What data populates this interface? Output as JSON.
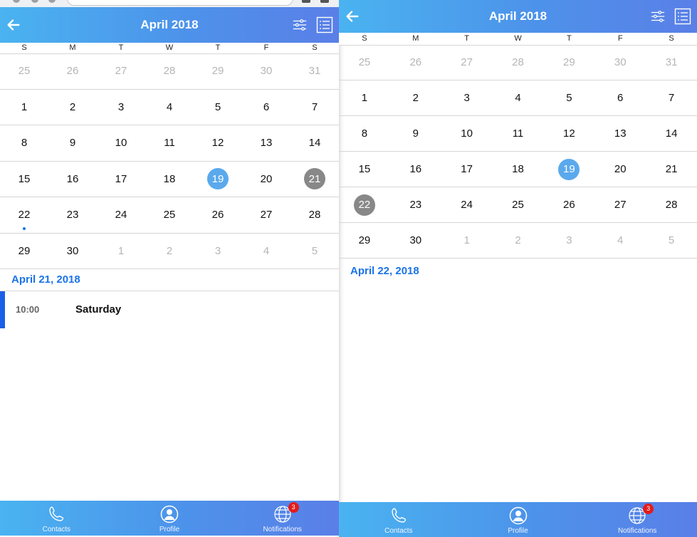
{
  "left": {
    "header": {
      "title": "April 2018"
    },
    "weekdays": [
      "S",
      "M",
      "T",
      "W",
      "T",
      "F",
      "S"
    ],
    "weeks": [
      [
        {
          "d": "25",
          "other": true
        },
        {
          "d": "26",
          "other": true
        },
        {
          "d": "27",
          "other": true
        },
        {
          "d": "28",
          "other": true
        },
        {
          "d": "29",
          "other": true
        },
        {
          "d": "30",
          "other": true
        },
        {
          "d": "31",
          "other": true
        }
      ],
      [
        {
          "d": "1"
        },
        {
          "d": "2"
        },
        {
          "d": "3"
        },
        {
          "d": "4"
        },
        {
          "d": "5"
        },
        {
          "d": "6"
        },
        {
          "d": "7"
        }
      ],
      [
        {
          "d": "8"
        },
        {
          "d": "9"
        },
        {
          "d": "10"
        },
        {
          "d": "11"
        },
        {
          "d": "12"
        },
        {
          "d": "13"
        },
        {
          "d": "14"
        }
      ],
      [
        {
          "d": "15"
        },
        {
          "d": "16"
        },
        {
          "d": "17"
        },
        {
          "d": "18"
        },
        {
          "d": "19",
          "today": true
        },
        {
          "d": "20"
        },
        {
          "d": "21",
          "selected": true
        }
      ],
      [
        {
          "d": "22",
          "event": true
        },
        {
          "d": "23"
        },
        {
          "d": "24"
        },
        {
          "d": "25"
        },
        {
          "d": "26"
        },
        {
          "d": "27"
        },
        {
          "d": "28"
        }
      ],
      [
        {
          "d": "29"
        },
        {
          "d": "30"
        },
        {
          "d": "1",
          "other": true
        },
        {
          "d": "2",
          "other": true
        },
        {
          "d": "3",
          "other": true
        },
        {
          "d": "4",
          "other": true
        },
        {
          "d": "5",
          "other": true
        }
      ]
    ],
    "selected_date": "April 21, 2018",
    "event": {
      "time": "10:00",
      "title": "Saturday"
    },
    "tabs": [
      {
        "label": "Contacts",
        "icon": "phone-icon"
      },
      {
        "label": "Profile",
        "icon": "profile-icon"
      },
      {
        "label": "Notifications",
        "icon": "globe-icon",
        "badge": "3"
      }
    ]
  },
  "right": {
    "header": {
      "title": "April 2018"
    },
    "weekdays": [
      "S",
      "M",
      "T",
      "W",
      "T",
      "F",
      "S"
    ],
    "weeks": [
      [
        {
          "d": "25",
          "other": true
        },
        {
          "d": "26",
          "other": true
        },
        {
          "d": "27",
          "other": true
        },
        {
          "d": "28",
          "other": true
        },
        {
          "d": "29",
          "other": true
        },
        {
          "d": "30",
          "other": true
        },
        {
          "d": "31",
          "other": true
        }
      ],
      [
        {
          "d": "1"
        },
        {
          "d": "2"
        },
        {
          "d": "3"
        },
        {
          "d": "4"
        },
        {
          "d": "5"
        },
        {
          "d": "6"
        },
        {
          "d": "7"
        }
      ],
      [
        {
          "d": "8"
        },
        {
          "d": "9"
        },
        {
          "d": "10"
        },
        {
          "d": "11"
        },
        {
          "d": "12"
        },
        {
          "d": "13"
        },
        {
          "d": "14"
        }
      ],
      [
        {
          "d": "15"
        },
        {
          "d": "16"
        },
        {
          "d": "17"
        },
        {
          "d": "18"
        },
        {
          "d": "19",
          "today": true
        },
        {
          "d": "20"
        },
        {
          "d": "21"
        }
      ],
      [
        {
          "d": "22",
          "selected": true
        },
        {
          "d": "23"
        },
        {
          "d": "24"
        },
        {
          "d": "25"
        },
        {
          "d": "26"
        },
        {
          "d": "27"
        },
        {
          "d": "28"
        }
      ],
      [
        {
          "d": "29"
        },
        {
          "d": "30"
        },
        {
          "d": "1",
          "other": true
        },
        {
          "d": "2",
          "other": true
        },
        {
          "d": "3",
          "other": true
        },
        {
          "d": "4",
          "other": true
        },
        {
          "d": "5",
          "other": true
        }
      ]
    ],
    "selected_date": "April 22, 2018",
    "tabs": [
      {
        "label": "Contacts",
        "icon": "phone-icon"
      },
      {
        "label": "Profile",
        "icon": "profile-icon"
      },
      {
        "label": "Notifications",
        "icon": "globe-icon",
        "badge": "3"
      }
    ]
  },
  "colors": {
    "accent": "#1a73e8",
    "today": "#5aa9ec",
    "selected": "#888888",
    "badge": "#e21b1b",
    "header_gradient": [
      "#4ab3f0",
      "#5a7fe7"
    ]
  }
}
